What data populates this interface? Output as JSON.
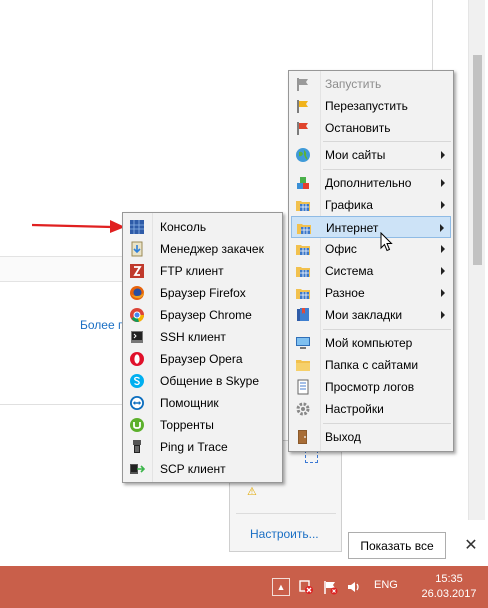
{
  "background": {
    "more_link": "Более п"
  },
  "main_menu": {
    "items": [
      {
        "label": "Запустить",
        "icon": "flag-gray-icon",
        "disabled": true,
        "submenu": false
      },
      {
        "label": "Перезапустить",
        "icon": "flag-yellow-icon",
        "disabled": false,
        "submenu": false
      },
      {
        "label": "Остановить",
        "icon": "flag-red-icon",
        "disabled": false,
        "submenu": false
      },
      {
        "label": "Мои сайты",
        "icon": "globe-icon",
        "disabled": false,
        "submenu": true
      },
      {
        "label": "Дополнительно",
        "icon": "blocks-icon",
        "disabled": false,
        "submenu": true
      },
      {
        "label": "Графика",
        "icon": "folder-grid-icon",
        "disabled": false,
        "submenu": true
      },
      {
        "label": "Интернет",
        "icon": "folder-grid-icon",
        "disabled": false,
        "submenu": true,
        "highlighted": true
      },
      {
        "label": "Офис",
        "icon": "folder-grid-icon",
        "disabled": false,
        "submenu": true
      },
      {
        "label": "Система",
        "icon": "folder-grid-icon",
        "disabled": false,
        "submenu": true
      },
      {
        "label": "Разное",
        "icon": "folder-grid-icon",
        "disabled": false,
        "submenu": true
      },
      {
        "label": "Мои закладки",
        "icon": "bookmarks-icon",
        "disabled": false,
        "submenu": true
      },
      {
        "label": "Мой компьютер",
        "icon": "computer-icon",
        "disabled": false,
        "submenu": false
      },
      {
        "label": "Папка с сайтами",
        "icon": "folder-icon",
        "disabled": false,
        "submenu": false
      },
      {
        "label": "Просмотр логов",
        "icon": "log-icon",
        "disabled": false,
        "submenu": false
      },
      {
        "label": "Настройки",
        "icon": "gear-icon",
        "disabled": false,
        "submenu": false
      },
      {
        "label": "Выход",
        "icon": "exit-door-icon",
        "disabled": false,
        "submenu": false
      }
    ]
  },
  "sub_menu": {
    "items": [
      {
        "label": "Консоль",
        "icon": "console-icon"
      },
      {
        "label": "Менеджер закачек",
        "icon": "download-manager-icon"
      },
      {
        "label": "FTP клиент",
        "icon": "filezilla-icon"
      },
      {
        "label": "Браузер Firefox",
        "icon": "firefox-icon"
      },
      {
        "label": "Браузер Chrome",
        "icon": "chrome-icon"
      },
      {
        "label": "SSH клиент",
        "icon": "ssh-icon"
      },
      {
        "label": "Браузер Opera",
        "icon": "opera-icon"
      },
      {
        "label": "Общение в Skype",
        "icon": "skype-icon"
      },
      {
        "label": "Помощник",
        "icon": "teamviewer-icon"
      },
      {
        "label": "Торренты",
        "icon": "utorrent-icon"
      },
      {
        "label": "Ping и Trace",
        "icon": "ping-icon"
      },
      {
        "label": "SCP клиент",
        "icon": "scp-icon"
      }
    ]
  },
  "tray_panel": {
    "configure_link": "Настроить..."
  },
  "notification": {
    "show_all_label": "Показать все",
    "close_glyph": "✕"
  },
  "taskbar": {
    "tray_up_glyph": "▲",
    "lang": "ENG",
    "time": "15:35",
    "date": "26.03.2017"
  },
  "colors": {
    "taskbar": "#c95f4a",
    "menu_bg": "#f2f2f2",
    "highlight": "#cde3f7",
    "link": "#1a6fc4",
    "arrow": "#e02020"
  }
}
